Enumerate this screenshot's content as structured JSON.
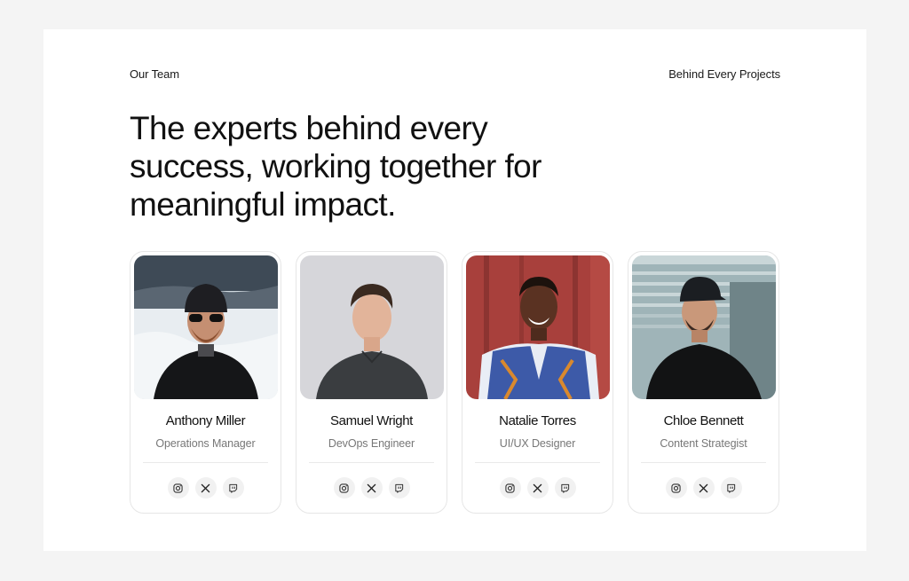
{
  "header": {
    "eyebrow_left": "Our Team",
    "eyebrow_right": "Behind Every Projects",
    "headline": "The experts behind every success, working together for meaningful impact."
  },
  "team": [
    {
      "name": "Anthony Miller",
      "role": "Operations Manager",
      "photo_icon": "portrait-photo",
      "socials": [
        "instagram-icon",
        "x-icon",
        "twitch-icon"
      ]
    },
    {
      "name": "Samuel Wright",
      "role": "DevOps Engineer",
      "photo_icon": "portrait-photo",
      "socials": [
        "instagram-icon",
        "x-icon",
        "twitch-icon"
      ]
    },
    {
      "name": "Natalie Torres",
      "role": "UI/UX Designer",
      "photo_icon": "portrait-photo",
      "socials": [
        "instagram-icon",
        "x-icon",
        "twitch-icon"
      ]
    },
    {
      "name": "Chloe Bennett",
      "role": "Content Strategist",
      "photo_icon": "portrait-photo",
      "socials": [
        "instagram-icon",
        "x-icon",
        "twitch-icon"
      ]
    }
  ],
  "colors": {
    "page_bg": "#f4f4f4",
    "panel_bg": "#ffffff",
    "text": "#111111",
    "muted": "#777777",
    "icon_bg": "#f1f1f1"
  }
}
